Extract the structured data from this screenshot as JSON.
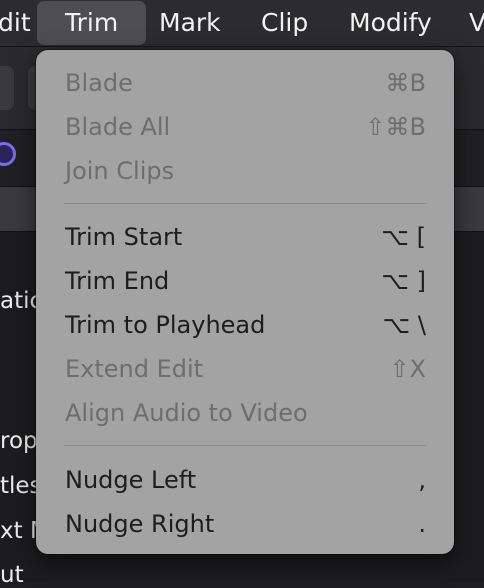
{
  "menubar": {
    "items": [
      {
        "label": "dit"
      },
      {
        "label": "Trim"
      },
      {
        "label": "Mark"
      },
      {
        "label": "Clip"
      },
      {
        "label": "Modify"
      },
      {
        "label": "V"
      }
    ]
  },
  "background": {
    "labels": [
      "atic",
      "rop",
      "tles",
      "xt M",
      "ut"
    ]
  },
  "trim_menu": {
    "items": [
      {
        "label": "Blade",
        "shortcut": "⌘B",
        "enabled": false
      },
      {
        "label": "Blade All",
        "shortcut": "⇧⌘B",
        "enabled": false
      },
      {
        "label": "Join Clips",
        "shortcut": "",
        "enabled": false
      },
      {
        "label": "Trim Start",
        "shortcut": "⌥ [",
        "enabled": true
      },
      {
        "label": "Trim End",
        "shortcut": "⌥ ]",
        "enabled": true
      },
      {
        "label": "Trim to Playhead",
        "shortcut": "⌥ \\",
        "enabled": true
      },
      {
        "label": "Extend Edit",
        "shortcut": "⇧X",
        "enabled": false
      },
      {
        "label": "Align Audio to Video",
        "shortcut": "",
        "enabled": false
      },
      {
        "label": "Nudge Left",
        "shortcut": ",",
        "enabled": true
      },
      {
        "label": "Nudge Right",
        "shortcut": ".",
        "enabled": true
      }
    ]
  },
  "colors": {
    "menu_background": "#a3a3a3",
    "enabled_text": "#1d1d1f",
    "disabled_text": "#6e6e70",
    "menubar_background": "#2c2c2e",
    "active_menu_highlight": "#4e4e52"
  }
}
